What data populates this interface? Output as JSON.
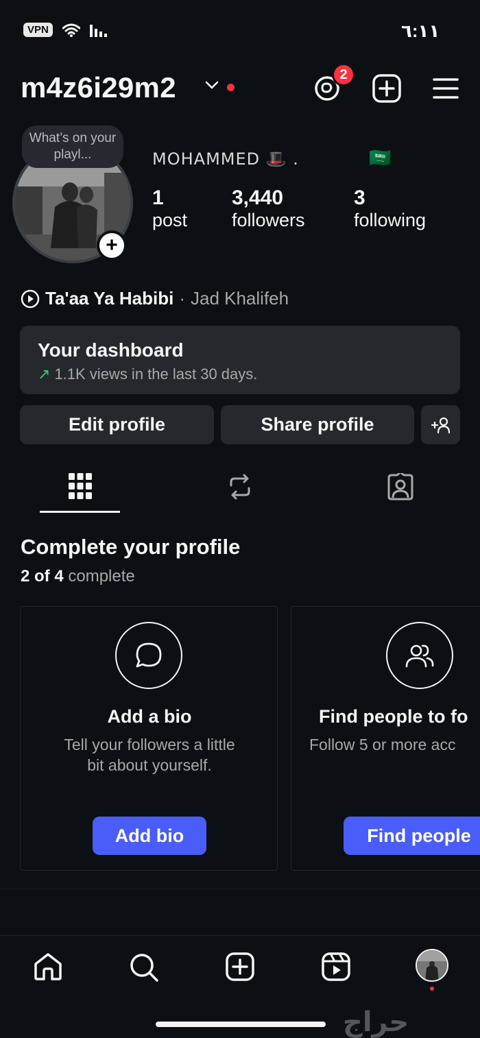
{
  "status_bar": {
    "time": "٦:١١",
    "vpn_label": "VPN"
  },
  "header": {
    "username": "m4z6i29m2",
    "notification_count": "2"
  },
  "profile": {
    "note": "What’s on your playl...",
    "display_name": "MOHAMMED 🎩 .",
    "flag": "🇸🇦",
    "stats": [
      {
        "value": "1",
        "label": "post"
      },
      {
        "value": "3,440",
        "label": "followers"
      },
      {
        "value": "3",
        "label": "following"
      }
    ]
  },
  "music": {
    "song": "Ta'aa Ya Habibi",
    "separator": "·",
    "artist": "Jad Khalifeh"
  },
  "dashboard": {
    "title": "Your dashboard",
    "subtitle": "1.1K views in the last 30 days.",
    "arrow": "↗"
  },
  "buttons": {
    "edit_profile": "Edit profile",
    "share_profile": "Share profile"
  },
  "complete_profile": {
    "title": "Complete your profile",
    "progress": "2 of 4",
    "progress_suffix": "complete",
    "cards": [
      {
        "title": "Add a bio",
        "desc_line1": "Tell your followers a little",
        "desc_line2": "bit about yourself.",
        "button": "Add bio"
      },
      {
        "title": "Find people to fo",
        "desc_line1": "Follow 5 or more acc",
        "button": "Find people"
      }
    ]
  },
  "watermark": "حراج",
  "colors": {
    "background": "#0c1014",
    "surface": "#25292e",
    "accent_blue": "#4a5df9",
    "badge_red": "#ff3040",
    "trend_green": "#2ecc71"
  }
}
